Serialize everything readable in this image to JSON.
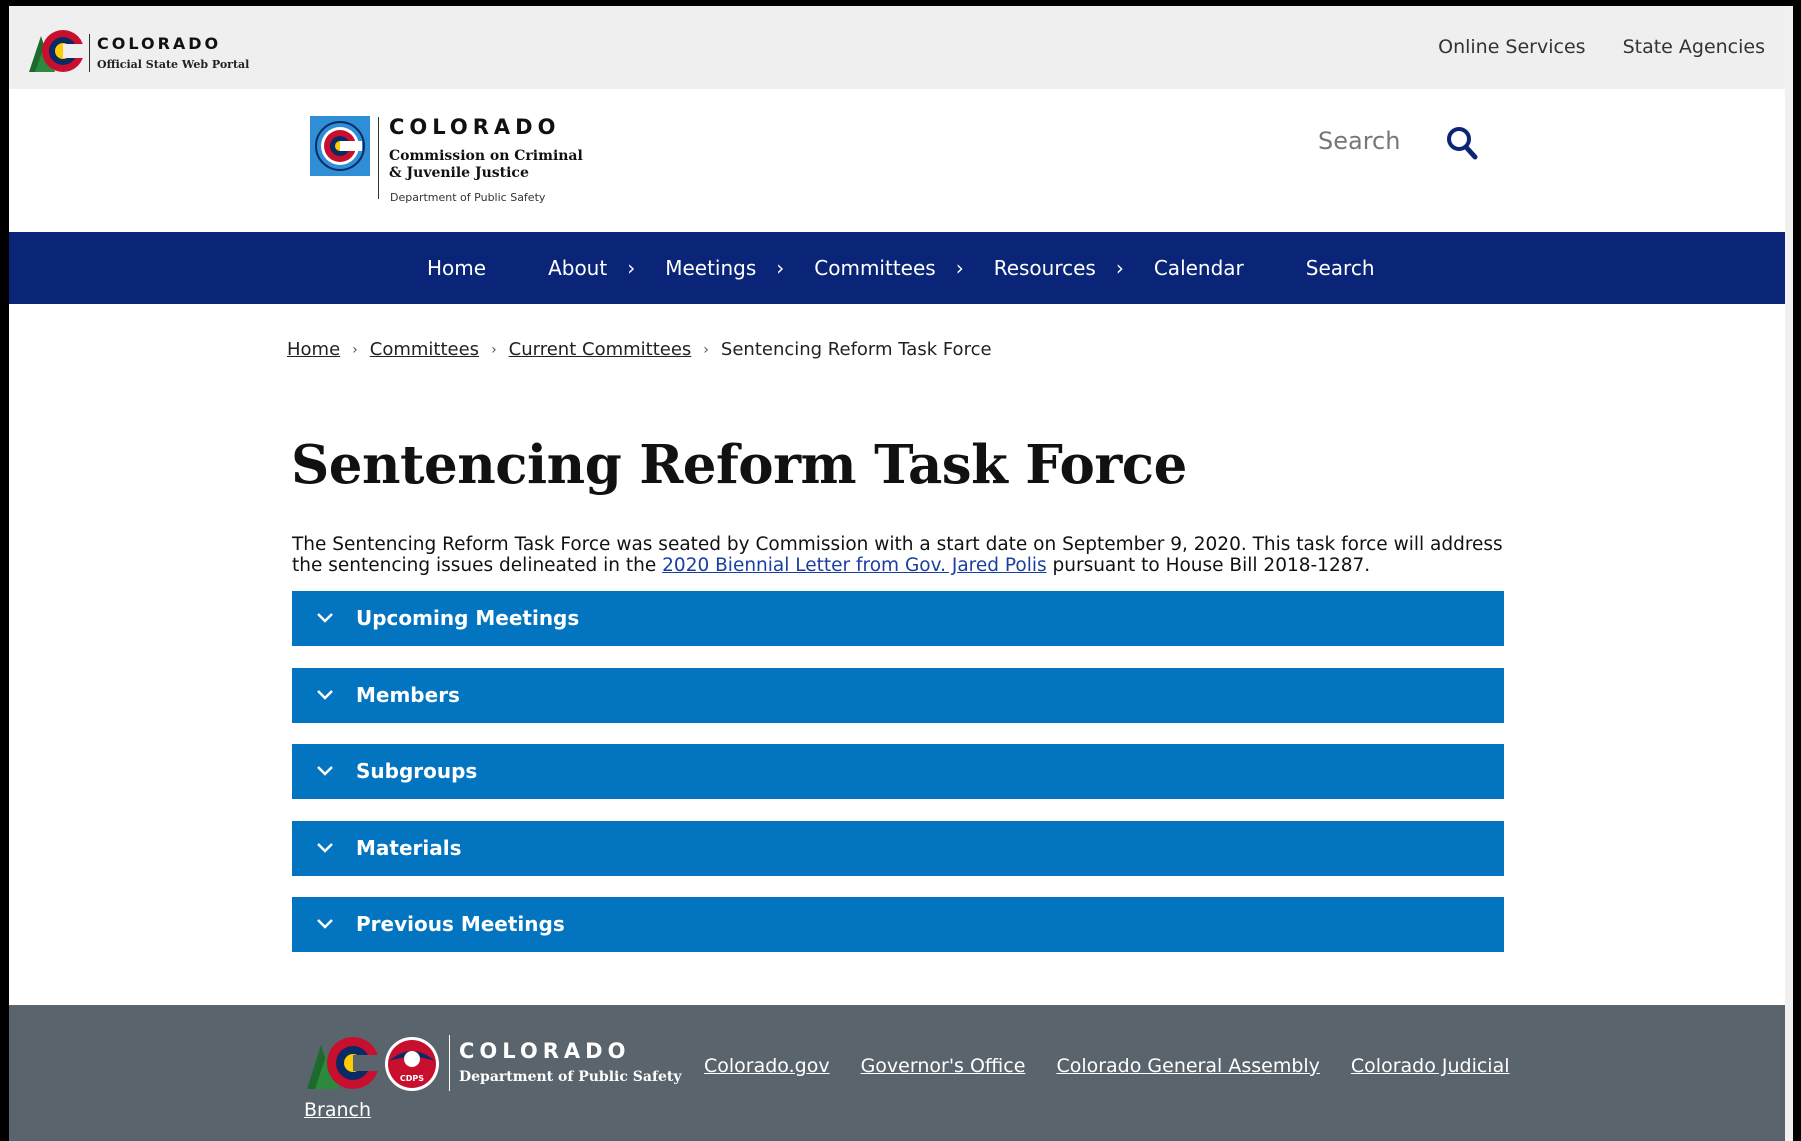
{
  "portal": {
    "title": "COLORADO",
    "subtitle": "Official State Web Portal",
    "links": [
      "Online Services",
      "State Agencies"
    ]
  },
  "agency": {
    "title": "COLORADO",
    "name_line1": "Commission on Criminal",
    "name_line2": "& Juvenile Justice",
    "department": "Department of Public Safety"
  },
  "search": {
    "label": "Search"
  },
  "nav": {
    "items": [
      {
        "label": "Home",
        "has_submenu": false
      },
      {
        "label": "About",
        "has_submenu": true
      },
      {
        "label": "Meetings",
        "has_submenu": true
      },
      {
        "label": "Committees",
        "has_submenu": true
      },
      {
        "label": "Resources",
        "has_submenu": true
      },
      {
        "label": "Calendar",
        "has_submenu": false
      },
      {
        "label": "Search",
        "has_submenu": false
      }
    ]
  },
  "breadcrumb": {
    "items": [
      "Home",
      "Committees",
      "Current Committees"
    ],
    "current": "Sentencing Reform Task Force"
  },
  "main": {
    "title": "Sentencing Reform Task Force",
    "intro_before": "The Sentencing Reform Task Force was seated by Commission with a start date on September 9, 2020. This task force will address the sentencing issues delineated in the ",
    "intro_link": "2020 Biennial Letter from Gov. Jared Polis",
    "intro_after": " pursuant to House Bill 2018-1287.",
    "accordions": [
      "Upcoming Meetings",
      "Members",
      "Subgroups",
      "Materials",
      "Previous Meetings"
    ]
  },
  "footer": {
    "title": "COLORADO",
    "subtitle": "Department of Public Safety",
    "badge": "CDPS",
    "links": [
      "Colorado.gov",
      "Governor's Office",
      "Colorado General Assembly",
      "Colorado Judicial"
    ],
    "wrapped_link": "Branch"
  },
  "colors": {
    "nav_bg": "#0a2577",
    "accordion_bg": "#0374c0",
    "footer_bg": "#5a646c",
    "portal_bg": "#efefef"
  }
}
